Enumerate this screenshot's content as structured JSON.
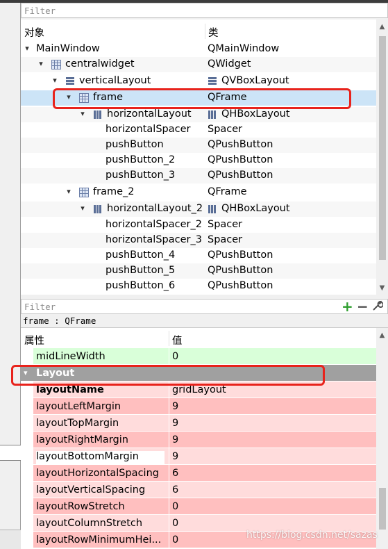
{
  "object_inspector": {
    "filter_placeholder": "Filter",
    "columns": {
      "object": "对象",
      "class": "类"
    },
    "rows": [
      {
        "name": "MainWindow",
        "class": "QMainWindow"
      },
      {
        "name": "centralwidget",
        "class": "QWidget"
      },
      {
        "name": "verticalLayout",
        "class": "QVBoxLayout"
      },
      {
        "name": "frame",
        "class": "QFrame"
      },
      {
        "name": "horizontalLayout",
        "class": "QHBoxLayout"
      },
      {
        "name": "horizontalSpacer",
        "class": "Spacer"
      },
      {
        "name": "pushButton",
        "class": "QPushButton"
      },
      {
        "name": "pushButton_2",
        "class": "QPushButton"
      },
      {
        "name": "pushButton_3",
        "class": "QPushButton"
      },
      {
        "name": "frame_2",
        "class": "QFrame"
      },
      {
        "name": "horizontalLayout_2",
        "class": "QHBoxLayout"
      },
      {
        "name": "horizontalSpacer_2",
        "class": "Spacer"
      },
      {
        "name": "horizontalSpacer_3",
        "class": "Spacer"
      },
      {
        "name": "pushButton_4",
        "class": "QPushButton"
      },
      {
        "name": "pushButton_5",
        "class": "QPushButton"
      },
      {
        "name": "pushButton_6",
        "class": "QPushButton"
      }
    ]
  },
  "property_editor": {
    "filter_placeholder": "Filter",
    "object_label": "frame : QFrame",
    "columns": {
      "property": "属性",
      "value": "值"
    },
    "rows": [
      {
        "name": "midLineWidth",
        "value": "0"
      },
      {
        "name": "Layout",
        "value": ""
      },
      {
        "name": "layoutName",
        "value": "gridLayout"
      },
      {
        "name": "layoutLeftMargin",
        "value": "9"
      },
      {
        "name": "layoutTopMargin",
        "value": "9"
      },
      {
        "name": "layoutRightMargin",
        "value": "9"
      },
      {
        "name": "layoutBottomMargin",
        "value": "9"
      },
      {
        "name": "layoutHorizontalSpacing",
        "value": "6"
      },
      {
        "name": "layoutVerticalSpacing",
        "value": "6"
      },
      {
        "name": "layoutRowStretch",
        "value": "0"
      },
      {
        "name": "layoutColumnStretch",
        "value": "0"
      },
      {
        "name": "layoutRowMinimumHei...",
        "value": "0"
      }
    ]
  },
  "icons": {
    "collapse": "▾",
    "add": "+",
    "remove": "−",
    "configure": "🔧",
    "scroll_up": "▲",
    "scroll_down": "▼"
  },
  "colors": {
    "selection": "#cce4f7",
    "highlight_box": "#e8231c",
    "group_header": "#a0a0a0",
    "changed_row": "#ffbfbf",
    "changed_row_alt": "#ffdcdc",
    "green_row": "#d9ffd9"
  },
  "watermark": "https://blog.csdn.net/sazas"
}
